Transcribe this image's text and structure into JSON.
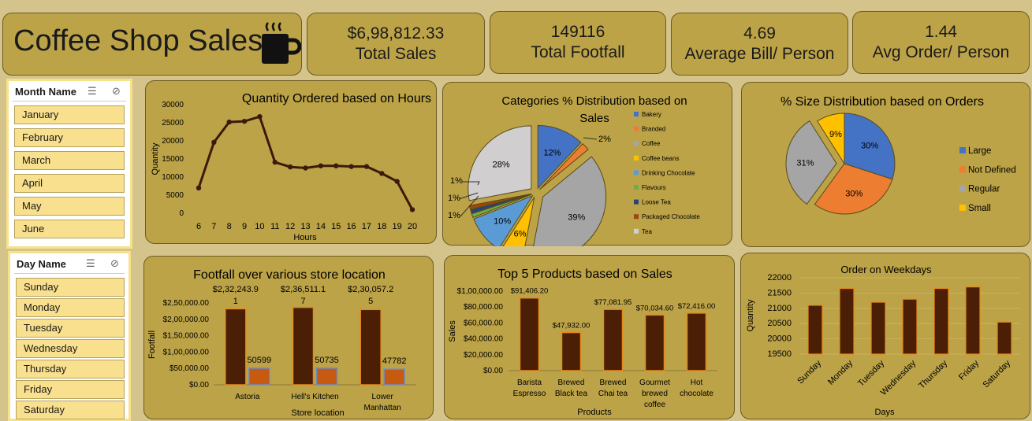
{
  "header": {
    "title": "Coffee Shop Sales",
    "icon": "coffee-cup-icon"
  },
  "kpis": [
    {
      "value": "$6,98,812.33",
      "label": "Total Sales"
    },
    {
      "value": "149116",
      "label": "Total Footfall"
    },
    {
      "value": "4.69",
      "label": "Average Bill/ Person"
    },
    {
      "value": "1.44",
      "label": "Avg Order/ Person"
    }
  ],
  "month_slicer": {
    "header": "Month Name",
    "items": [
      "January",
      "February",
      "March",
      "April",
      "May",
      "June"
    ]
  },
  "day_slicer": {
    "header": "Day Name",
    "items": [
      "Sunday",
      "Monday",
      "Tuesday",
      "Wednesday",
      "Thursday",
      "Friday",
      "Saturday"
    ]
  },
  "colors": {
    "bg": "#d4c48c",
    "card": "#bca347",
    "bar_dark": "#4a1f05",
    "bar_orange": "#c65a11",
    "line": "#3a1a0b"
  },
  "chart_data": [
    {
      "type": "line",
      "title": "Quantity Ordered based on Hours",
      "xlabel": "Hours",
      "ylabel": "Quantity",
      "x": [
        6,
        7,
        8,
        9,
        10,
        11,
        12,
        13,
        14,
        15,
        16,
        17,
        18,
        19,
        20
      ],
      "values": [
        7000,
        19600,
        25200,
        25400,
        26700,
        14100,
        12800,
        12500,
        13100,
        13100,
        12900,
        12900,
        11000,
        8800,
        1000
      ],
      "ylim": [
        0,
        30000
      ],
      "yticks": [
        "0",
        "5000",
        "10000",
        "15000",
        "20000",
        "25000",
        "30000"
      ]
    },
    {
      "type": "pie",
      "title": "Categories % Distribution based on Sales",
      "labels": [
        "Bakery",
        "Branded",
        "Coffee",
        "Coffee beans",
        "Drinking Chocolate",
        "Flavours",
        "Loose Tea",
        "Packaged Chocolate",
        "Tea"
      ],
      "values": [
        12,
        2,
        39,
        6,
        10,
        1,
        1,
        1,
        28
      ],
      "value_labels": [
        "12%",
        "2%",
        "39%",
        "6%",
        "10%",
        "1%",
        "1%",
        "1%",
        "28%"
      ],
      "colors": [
        "#4472c4",
        "#ed7d31",
        "#a5a5a5",
        "#ffc000",
        "#5b9bd5",
        "#70ad47",
        "#264478",
        "#9e480e",
        "#d0cece"
      ]
    },
    {
      "type": "pie",
      "title": "% Size Distribution based on Orders",
      "labels": [
        "Large",
        "Not Defined",
        "Regular",
        "Small"
      ],
      "values": [
        30,
        30,
        31,
        9
      ],
      "value_labels": [
        "30%",
        "30%",
        "31%",
        "9%"
      ],
      "colors": [
        "#4472c4",
        "#ed7d31",
        "#a5a5a5",
        "#ffc000"
      ]
    },
    {
      "type": "bar",
      "title": "Footfall over various store location",
      "xlabel": "Store location",
      "ylabel": "Footfall",
      "categories": [
        "Astoria",
        "Hell's Kitchen",
        "Lower Manhattan"
      ],
      "series": [
        {
          "values": [
            232243.91,
            236511.17,
            230057.25
          ],
          "labels": [
            "$2,32,243.9",
            "$2,36,511.1",
            "$2,30,057.2"
          ],
          "label_tails": [
            "1",
            "7",
            "5"
          ]
        },
        {
          "values": [
            50599,
            50735,
            47782
          ],
          "labels": [
            "50599",
            "50735",
            "47782"
          ]
        }
      ],
      "ylim": [
        0,
        250000
      ],
      "yticks": [
        "$0.00",
        "$50,000.00",
        "$1,00,000.00",
        "$1,50,000.00",
        "$2,00,000.00",
        "$2,50,000.00"
      ]
    },
    {
      "type": "bar",
      "title": "Top 5 Products based on Sales",
      "xlabel": "Products",
      "ylabel": "Sales",
      "categories": [
        "Barista Espresso",
        "Brewed Black tea",
        "Brewed Chai tea",
        "Gourmet brewed coffee",
        "Hot chocolate"
      ],
      "values": [
        91406.2,
        47932.0,
        77081.95,
        70034.6,
        72416.0
      ],
      "labels": [
        "$91,406.20",
        "$47,932.00",
        "$77,081.95",
        "$70,034.60",
        "$72,416.00"
      ],
      "ylim": [
        0,
        100000
      ],
      "yticks": [
        "$0.00",
        "$20,000.00",
        "$40,000.00",
        "$60,000.00",
        "$80,000.00",
        "$1,00,000.00"
      ]
    },
    {
      "type": "bar",
      "title": "Order on Weekdays",
      "xlabel": "Days",
      "ylabel": "Quantity",
      "categories": [
        "Sunday",
        "Monday",
        "Tuesday",
        "Wednesday",
        "Thursday",
        "Friday",
        "Saturday"
      ],
      "values": [
        21100,
        21650,
        21200,
        21300,
        21650,
        21700,
        20550
      ],
      "ylim": [
        19500,
        22000
      ],
      "yticks": [
        "19500",
        "20000",
        "20500",
        "21000",
        "21500",
        "22000"
      ]
    }
  ]
}
